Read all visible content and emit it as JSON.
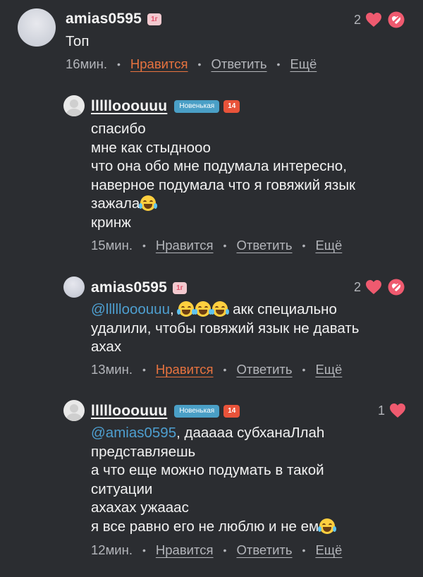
{
  "comments": [
    {
      "username": "amias0595",
      "level_badge": "1г",
      "likes": "2",
      "text": "Топ",
      "time": "16мин.",
      "like_label": "Нравится",
      "reply_label": "Ответить",
      "more_label": "Ещё"
    },
    {
      "username": "lllllooouuu",
      "new_badge": "Новенькая",
      "age_badge": "14",
      "text": "спасибо\nмне как стыдноoo\nчто она обо мне подумала интересно,\nнаверное подумала что я говяжий язык\nзажала",
      "text_tail": "кринж",
      "time": "15мин.",
      "like_label": "Нравится",
      "reply_label": "Ответить",
      "more_label": "Ещё"
    },
    {
      "username": "amias0595",
      "level_badge": "1г",
      "likes": "2",
      "mention": "@lllllooouuu",
      "text_after_emoji": "акк специально\nудалили, чтобы говяжий язык не давать\nахах",
      "time": "13мин.",
      "like_label": "Нравится",
      "reply_label": "Ответить",
      "more_label": "Ещё"
    },
    {
      "username": "lllllooouuu",
      "new_badge": "Новенькая",
      "age_badge": "14",
      "likes": "1",
      "mention": "@amias0595",
      "text": ", дааааа субханаЛлаh\nпредставляешь\nа что еще можно подумать в такой\nситуации\nахахах ужааас\nя все равно его не люблю и не ем",
      "time": "12мин.",
      "like_label": "Нравится",
      "reply_label": "Ответить",
      "more_label": "Ещё"
    }
  ],
  "colors": {
    "background": "#2b2d31",
    "heart": "#ef5a6f",
    "liked_action": "#e8733f",
    "mention": "#4e9fd0",
    "new_badge": "#4a9fc6",
    "age_badge": "#e8533a"
  },
  "icons": {
    "like": "heart-icon",
    "dislike": "broken-heart-icon",
    "emoji_cry": "loudly-crying-face-emoji",
    "emoji_laugh": "tears-of-joy-emoji"
  }
}
